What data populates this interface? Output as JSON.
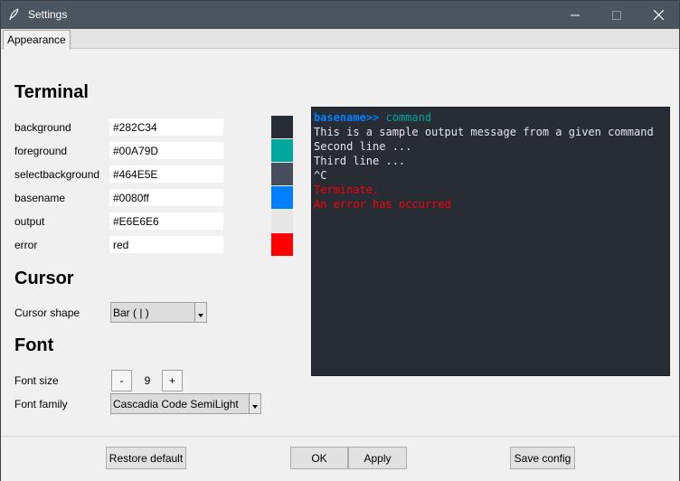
{
  "window": {
    "title": "Settings"
  },
  "tabs": [
    {
      "label": "Appearance"
    }
  ],
  "terminal": {
    "heading": "Terminal",
    "rows": [
      {
        "label": "background",
        "value": "#282C34",
        "color": "#282C34"
      },
      {
        "label": "foreground",
        "value": "#00A79D",
        "color": "#00A79D"
      },
      {
        "label": "selectbackground",
        "value": "#464E5E",
        "color": "#464E5E"
      },
      {
        "label": "basename",
        "value": "#0080ff",
        "color": "#0080ff"
      },
      {
        "label": "output",
        "value": "#E6E6E6",
        "color": "#E6E6E6"
      },
      {
        "label": "error",
        "value": "red",
        "color": "#ff0000"
      }
    ]
  },
  "cursor": {
    "heading": "Cursor",
    "shape_label": "Cursor shape",
    "shape_value": "Bar ( | )"
  },
  "font": {
    "heading": "Font",
    "size_label": "Font size",
    "size_value": "9",
    "dec_label": "-",
    "inc_label": "+",
    "family_label": "Font family",
    "family_value": "Cascadia Code SemiLight"
  },
  "preview": {
    "prompt": "basename>>",
    "command": "command",
    "output_lines": [
      "This is a sample output message from a given command",
      "Second line ...",
      "Third line ...",
      "^C"
    ],
    "error_lines": [
      "Terminate.",
      "An error has occurred"
    ]
  },
  "buttons": {
    "restore": "Restore default",
    "ok": "OK",
    "apply": "Apply",
    "save": "Save config"
  }
}
